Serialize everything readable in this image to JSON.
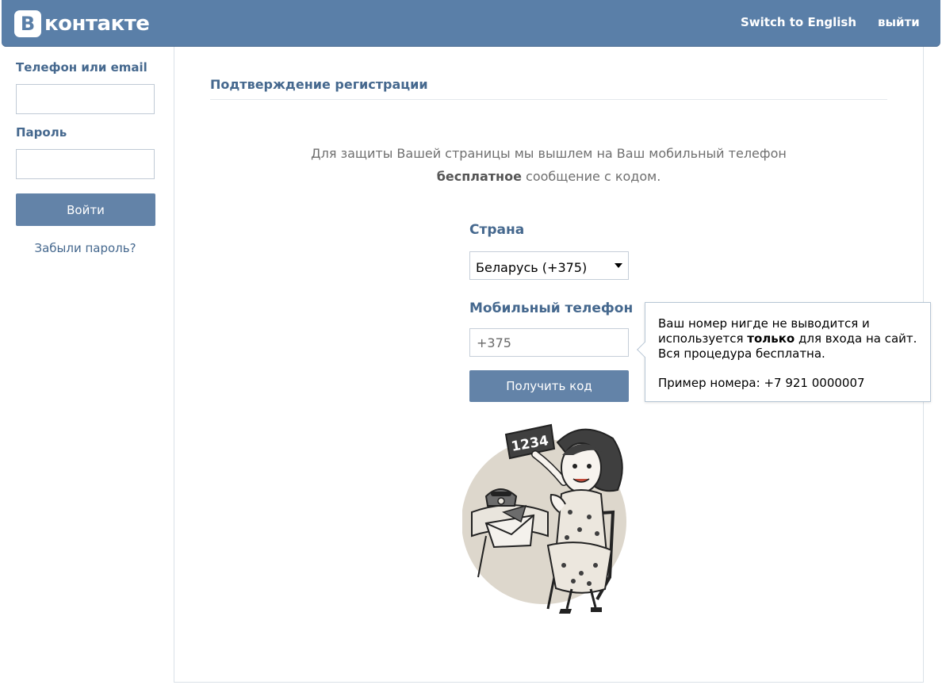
{
  "header": {
    "logo_letter": "В",
    "logo_text": "контакте",
    "switch_language": "Switch to English",
    "logout": "выйти"
  },
  "sidebar": {
    "login_label": "Телефон или email",
    "login_value": "",
    "password_label": "Пароль",
    "password_value": "",
    "login_button": "Войти",
    "forgot_link": "Забыли пароль?"
  },
  "main": {
    "title": "Подтверждение регистрации",
    "intro_line1": "Для защиты Вашей страницы мы вышлем на Ваш мобильный телефон",
    "intro_bold": "бесплатное",
    "intro_rest": " сообщение с кодом.",
    "country_label": "Страна",
    "country_value": "Беларусь (+375)",
    "phone_label": "Мобильный телефон",
    "phone_value": "+375",
    "get_code_button": "Получить код",
    "illustration_code": "1234"
  },
  "tooltip": {
    "line1": "Ваш номер нигде не выводится и",
    "line2_pre": "используется ",
    "line2_bold": "только",
    "line2_post": " для входа на сайт.",
    "line3": "Вся процедура бесплатна.",
    "example": "Пример номера: +7 921 0000007"
  },
  "colors": {
    "header_bg": "#5a7fa8",
    "link_blue": "#45688e",
    "button_bg": "#6383a8"
  }
}
